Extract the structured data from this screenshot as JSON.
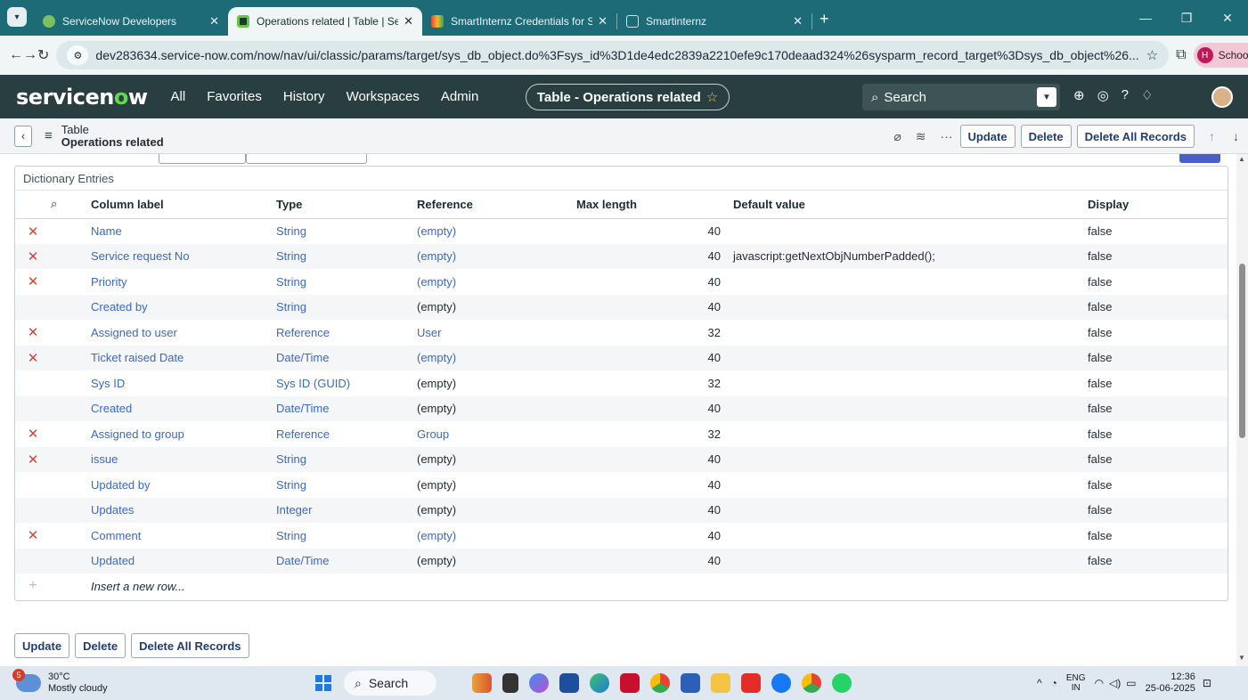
{
  "browser": {
    "tabs": [
      {
        "title": "ServiceNow Developers",
        "active": false
      },
      {
        "title": "Operations related | Table | Serv",
        "active": true
      },
      {
        "title": "SmartInternz Credentials for Sh",
        "active": false
      },
      {
        "title": "Smartinternz",
        "active": false
      }
    ],
    "new_tab": "+",
    "url": "dev283634.service-now.com/now/nav/ui/classic/params/target/sys_db_object.do%3Fsys_id%3D1de4edc2839a2210efe9c170deaad324%26sysparm_record_target%3Dsys_db_object%26...",
    "profile": "School",
    "profile_initial": "H"
  },
  "header": {
    "logo_a": "servicen",
    "logo_o": "o",
    "logo_b": "w",
    "nav": [
      "All",
      "Favorites",
      "History",
      "Workspaces",
      "Admin"
    ],
    "context": "Table - Operations related",
    "search": "Search"
  },
  "form": {
    "title_line1": "Table",
    "title_line2": "Operations related",
    "buttons": {
      "update": "Update",
      "delete": "Delete",
      "delete_all": "Delete All Records"
    }
  },
  "list": {
    "title": "Dictionary Entries",
    "columns": [
      "Column label",
      "Type",
      "Reference",
      "Max length",
      "Default value",
      "Display"
    ],
    "rows": [
      {
        "del": true,
        "label": "Name",
        "type": "String",
        "ref": "(empty)",
        "ref_link": true,
        "max": "40",
        "default": "",
        "display": "false"
      },
      {
        "del": true,
        "label": "Service request No",
        "type": "String",
        "ref": "(empty)",
        "ref_link": true,
        "max": "40",
        "default": "javascript:getNextObjNumberPadded();",
        "display": "false"
      },
      {
        "del": true,
        "label": "Priority",
        "type": "String",
        "ref": "(empty)",
        "ref_link": true,
        "max": "40",
        "default": "",
        "display": "false"
      },
      {
        "del": false,
        "label": "Created by",
        "type": "String",
        "ref": "(empty)",
        "ref_link": false,
        "max": "40",
        "default": "",
        "display": "false"
      },
      {
        "del": true,
        "label": "Assigned to user",
        "type": "Reference",
        "ref": "User",
        "ref_link": true,
        "max": "32",
        "default": "",
        "display": "false"
      },
      {
        "del": true,
        "label": "Ticket raised Date",
        "type": "Date/Time",
        "ref": "(empty)",
        "ref_link": true,
        "max": "40",
        "default": "",
        "display": "false"
      },
      {
        "del": false,
        "label": "Sys ID",
        "type": "Sys ID (GUID)",
        "ref": "(empty)",
        "ref_link": false,
        "max": "32",
        "default": "",
        "display": "false"
      },
      {
        "del": false,
        "label": "Created",
        "type": "Date/Time",
        "ref": "(empty)",
        "ref_link": false,
        "max": "40",
        "default": "",
        "display": "false"
      },
      {
        "del": true,
        "label": "Assigned to group",
        "type": "Reference",
        "ref": "Group",
        "ref_link": true,
        "max": "32",
        "default": "",
        "display": "false"
      },
      {
        "del": true,
        "label": "issue",
        "type": "String",
        "ref": "(empty)",
        "ref_link": false,
        "max": "40",
        "default": "",
        "display": "false"
      },
      {
        "del": false,
        "label": "Updated by",
        "type": "String",
        "ref": "(empty)",
        "ref_link": false,
        "max": "40",
        "default": "",
        "display": "false"
      },
      {
        "del": false,
        "label": "Updates",
        "type": "Integer",
        "ref": "(empty)",
        "ref_link": false,
        "max": "40",
        "default": "",
        "display": "false"
      },
      {
        "del": true,
        "label": "Comment",
        "type": "String",
        "ref": "(empty)",
        "ref_link": true,
        "max": "40",
        "default": "",
        "display": "false"
      },
      {
        "del": false,
        "label": "Updated",
        "type": "Date/Time",
        "ref": "(empty)",
        "ref_link": false,
        "max": "40",
        "default": "",
        "display": "false"
      }
    ],
    "insert_row": "Insert a new row..."
  },
  "taskbar": {
    "weather_temp": "30°C",
    "weather_desc": "Mostly cloudy",
    "weather_badge": "5",
    "search": "Search",
    "lang_1": "ENG",
    "lang_2": "IN",
    "time": "12:36",
    "date": "25-06-2025"
  },
  "colors": {
    "sn_header": "#293e40",
    "link": "#3b67c7",
    "delete_x": "#d0463e",
    "button_text": "#1f3d74",
    "browser_frame": "#1c6b77"
  }
}
